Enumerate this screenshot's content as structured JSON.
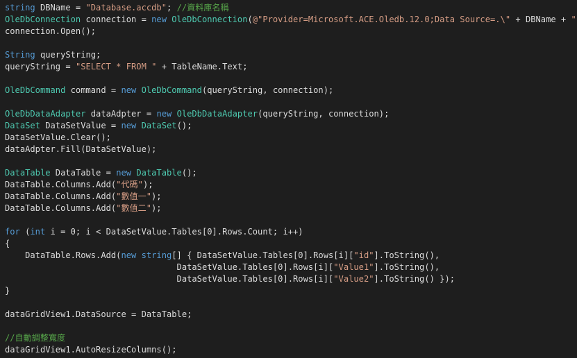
{
  "editor": {
    "colors": {
      "background": "#1e1e1e",
      "keyword": "#569cd6",
      "type": "#4ec9b0",
      "string": "#d69d85",
      "comment": "#57a64a",
      "plain": "#dcdcdc"
    },
    "lines": [
      [
        [
          "kw",
          "string"
        ],
        [
          "pl",
          " DBName = "
        ],
        [
          "str",
          "\"Database.accdb\""
        ],
        [
          "pl",
          "; "
        ],
        [
          "cm",
          "//資料庫名稱"
        ]
      ],
      [
        [
          "ty",
          "OleDbConnection"
        ],
        [
          "pl",
          " connection = "
        ],
        [
          "kw",
          "new"
        ],
        [
          "pl",
          " "
        ],
        [
          "ty",
          "OleDbConnection"
        ],
        [
          "pl",
          "("
        ],
        [
          "str",
          "@\"Provider=Microsoft.ACE.Oledb.12.0;Data Source=.\\\""
        ],
        [
          "pl",
          " + DBName + "
        ],
        [
          "str",
          "\";\""
        ],
        [
          "pl",
          ");"
        ]
      ],
      [
        [
          "pl",
          "connection.Open();"
        ]
      ],
      [],
      [
        [
          "kw",
          "String"
        ],
        [
          "pl",
          " queryString;"
        ]
      ],
      [
        [
          "pl",
          "queryString = "
        ],
        [
          "str",
          "\"SELECT * FROM \""
        ],
        [
          "pl",
          " + TableName.Text;"
        ]
      ],
      [],
      [
        [
          "ty",
          "OleDbCommand"
        ],
        [
          "pl",
          " command = "
        ],
        [
          "kw",
          "new"
        ],
        [
          "pl",
          " "
        ],
        [
          "ty",
          "OleDbCommand"
        ],
        [
          "pl",
          "(queryString, connection);"
        ]
      ],
      [],
      [
        [
          "ty",
          "OleDbDataAdapter"
        ],
        [
          "pl",
          " dataAdpter = "
        ],
        [
          "kw",
          "new"
        ],
        [
          "pl",
          " "
        ],
        [
          "ty",
          "OleDbDataAdapter"
        ],
        [
          "pl",
          "(queryString, connection);"
        ]
      ],
      [
        [
          "ty",
          "DataSet"
        ],
        [
          "pl",
          " DataSetValue = "
        ],
        [
          "kw",
          "new"
        ],
        [
          "pl",
          " "
        ],
        [
          "ty",
          "DataSet"
        ],
        [
          "pl",
          "();"
        ]
      ],
      [
        [
          "pl",
          "DataSetValue.Clear();"
        ]
      ],
      [
        [
          "pl",
          "dataAdpter.Fill(DataSetValue);"
        ]
      ],
      [],
      [
        [
          "ty",
          "DataTable"
        ],
        [
          "pl",
          " DataTable = "
        ],
        [
          "kw",
          "new"
        ],
        [
          "pl",
          " "
        ],
        [
          "ty",
          "DataTable"
        ],
        [
          "pl",
          "();"
        ]
      ],
      [
        [
          "pl",
          "DataTable.Columns.Add("
        ],
        [
          "str",
          "\"代碼\""
        ],
        [
          "pl",
          ");"
        ]
      ],
      [
        [
          "pl",
          "DataTable.Columns.Add("
        ],
        [
          "str",
          "\"數值一\""
        ],
        [
          "pl",
          ");"
        ]
      ],
      [
        [
          "pl",
          "DataTable.Columns.Add("
        ],
        [
          "str",
          "\"數值二\""
        ],
        [
          "pl",
          ");"
        ]
      ],
      [],
      [
        [
          "kw",
          "for"
        ],
        [
          "pl",
          " ("
        ],
        [
          "kw",
          "int"
        ],
        [
          "pl",
          " i = 0; i < DataSetValue.Tables[0].Rows.Count; i++)"
        ]
      ],
      [
        [
          "pl",
          "{"
        ]
      ],
      [
        [
          "pl",
          "    DataTable.Rows.Add("
        ],
        [
          "kw",
          "new"
        ],
        [
          "pl",
          " "
        ],
        [
          "kw",
          "string"
        ],
        [
          "pl",
          "[] { DataSetValue.Tables[0].Rows[i]["
        ],
        [
          "str",
          "\"id\""
        ],
        [
          "pl",
          "].ToString(),"
        ]
      ],
      [
        [
          "pl",
          "                                  DataSetValue.Tables[0].Rows[i]["
        ],
        [
          "str",
          "\"Value1\""
        ],
        [
          "pl",
          "].ToString(),"
        ]
      ],
      [
        [
          "pl",
          "                                  DataSetValue.Tables[0].Rows[i]["
        ],
        [
          "str",
          "\"Value2\""
        ],
        [
          "pl",
          "].ToString() });"
        ]
      ],
      [
        [
          "pl",
          "}"
        ]
      ],
      [],
      [
        [
          "pl",
          "dataGridView1.DataSource = DataTable;"
        ]
      ],
      [],
      [
        [
          "cm",
          "//自動調整寬度"
        ]
      ],
      [
        [
          "pl",
          "dataGridView1.AutoResizeColumns();"
        ]
      ]
    ]
  }
}
